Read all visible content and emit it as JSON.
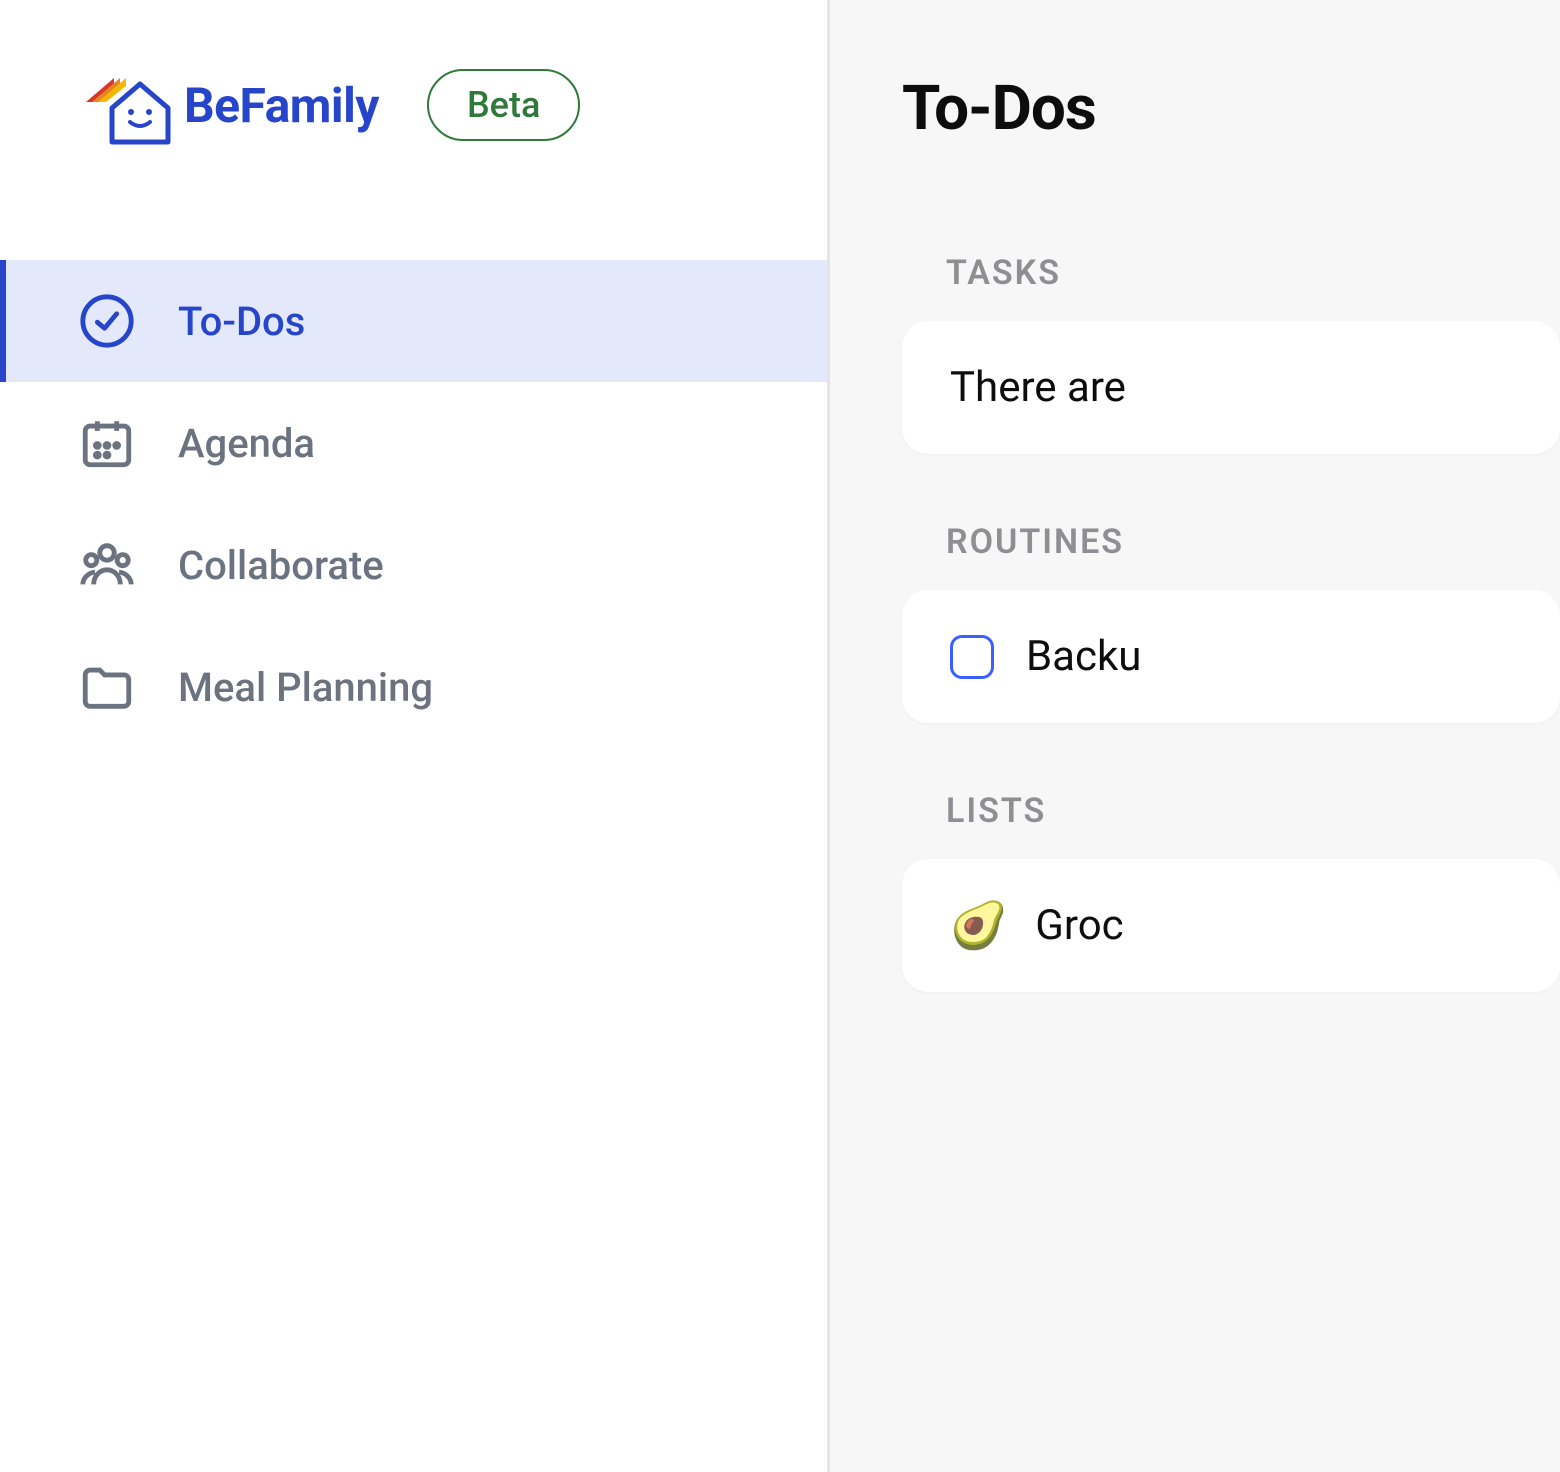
{
  "brand": {
    "name": "BeFamily",
    "badge": "Beta"
  },
  "sidebar": {
    "items": [
      {
        "label": "To-Dos",
        "icon": "check-circle-icon",
        "active": true
      },
      {
        "label": "Agenda",
        "icon": "calendar-icon",
        "active": false
      },
      {
        "label": "Collaborate",
        "icon": "people-icon",
        "active": false
      },
      {
        "label": "Meal Planning",
        "icon": "folder-icon",
        "active": false
      }
    ]
  },
  "main": {
    "title": "To-Dos",
    "sections": {
      "tasks": {
        "header": "TASKS",
        "empty_text": "There are"
      },
      "routines": {
        "header": "ROUTINES",
        "items": [
          {
            "label": "Backu",
            "checked": false
          }
        ]
      },
      "lists": {
        "header": "LISTS",
        "items": [
          {
            "label": "Groc",
            "emoji": "🥑"
          }
        ]
      }
    }
  }
}
